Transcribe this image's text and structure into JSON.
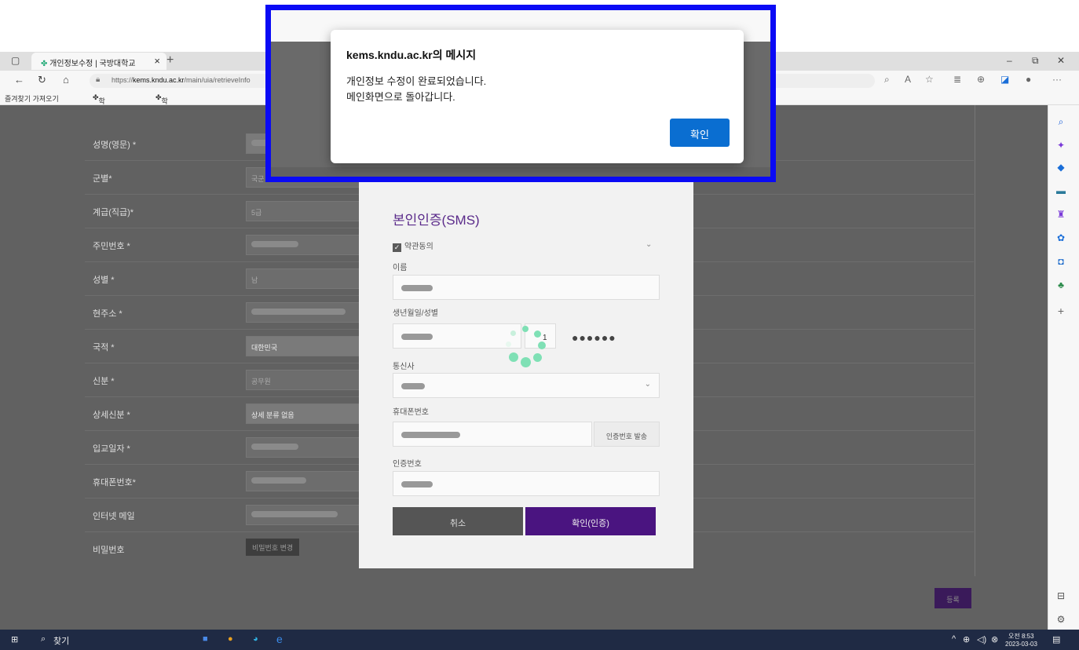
{
  "browser": {
    "tab_title": "개인정보수정 | 국방대학교",
    "tab_close": "×",
    "new_tab": "+",
    "url_prefix": "https://",
    "url_host": "kems.kndu.ac.kr",
    "url_path": "/main/uia/retrieveInfo",
    "favorites": [
      "즐겨찾기 가져오기",
      "학사관리포털",
      "학사관리시스템"
    ]
  },
  "form": {
    "rows": [
      {
        "label": "성명(영문) *",
        "value": ""
      },
      {
        "label": "군별*",
        "value": "국군"
      },
      {
        "label": "계급(직급)*",
        "value": "5급"
      },
      {
        "label": "주민번호 *",
        "value": ""
      },
      {
        "label": "성별 *",
        "value": "남"
      },
      {
        "label": "현주소 *",
        "value": ""
      },
      {
        "label": "국적 *",
        "value": "대한민국"
      },
      {
        "label": "신분 *",
        "value": "공무원"
      },
      {
        "label": "상세신분 *",
        "value": "상세 분류 없음"
      },
      {
        "label": "입교일자 *",
        "value": ""
      },
      {
        "label": "휴대폰번호*",
        "value": ""
      },
      {
        "label": "인터넷 메일",
        "value": ""
      },
      {
        "label": "비밀번호",
        "value": ""
      }
    ],
    "password_button": "비밀번호 변경",
    "submit_button": "등록"
  },
  "sms_modal": {
    "title": "본인인증(SMS)",
    "agree_label": "약관동의",
    "name_label": "이름",
    "birth_label": "생년월일/성별",
    "gender_digit": "1",
    "masked_digits": "●●●●●●",
    "carrier_label": "통신사",
    "phone_label": "휴대폰번호",
    "send_code_button": "인증번호 발송",
    "code_label": "인증번호",
    "cancel_button": "취소",
    "confirm_button": "확인(인증)"
  },
  "alert": {
    "title": "kems.kndu.ac.kr의 메시지",
    "message": "개인정보 수정이 완료되었습니다.\n메인화면으로 돌아갑니다.",
    "ok_button": "확인"
  },
  "taskbar": {
    "search_label": "찾기",
    "time": "오전 8:53",
    "date": "2023-03-03"
  },
  "colors": {
    "highlight_border": "#0a0af5",
    "dialog_button": "#0a6ed1",
    "modal_accent": "#4a1480"
  }
}
